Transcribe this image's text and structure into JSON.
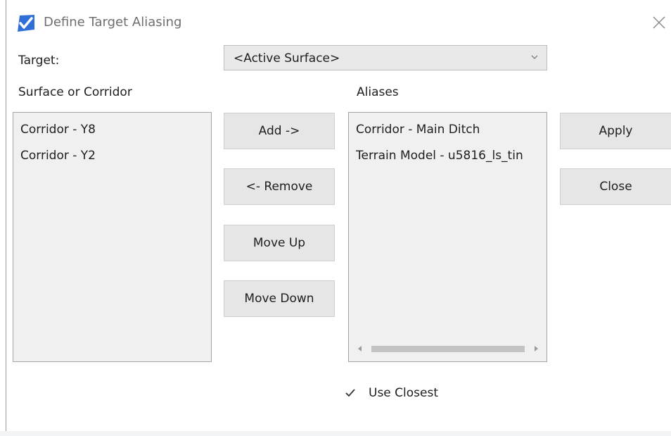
{
  "window": {
    "title": "Define Target Aliasing"
  },
  "target": {
    "label": "Target:",
    "selected_value": "<Active Surface>"
  },
  "surface_list": {
    "header": "Surface or Corridor",
    "items": [
      "Corridor - Y8",
      "Corridor - Y2"
    ]
  },
  "alias_list": {
    "header": "Aliases",
    "items": [
      "Corridor - Main Ditch",
      "Terrain Model - u5816_ls_tin"
    ]
  },
  "buttons": {
    "add": "Add ->",
    "remove": "<- Remove",
    "move_up": "Move Up",
    "move_down": "Move Down",
    "apply": "Apply",
    "close": "Close"
  },
  "use_closest": {
    "label": "Use Closest",
    "checked": true
  },
  "colors": {
    "icon_blue": "#2f6fd6",
    "button_bg": "#e6e6e6",
    "list_bg": "#f0f0f0"
  },
  "icons": {
    "app": "app-logo-icon",
    "close": "close-icon",
    "dropdown": "chevron-down-icon",
    "check": "checkmark-icon"
  }
}
